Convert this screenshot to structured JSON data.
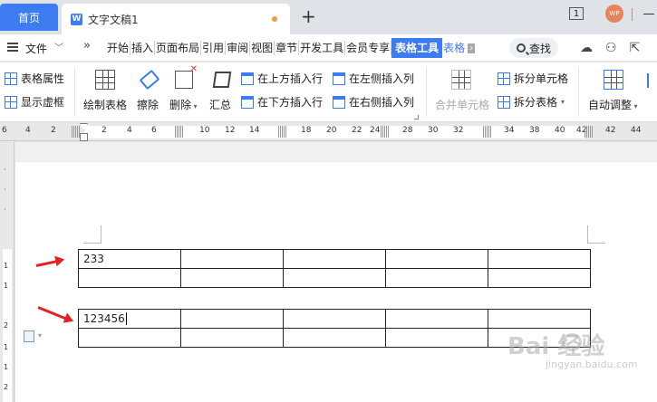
{
  "tabs": {
    "home": "首页",
    "document_title": "文字文稿1",
    "doc_icon": "W",
    "new_tab": "+",
    "window_count": "1",
    "avatar": "WP"
  },
  "menu": {
    "file": "文件",
    "items": [
      "开始",
      "插入",
      "页面布局",
      "引用",
      "审阅",
      "视图",
      "章节",
      "开发工具",
      "会员专享"
    ],
    "active": "表格工具",
    "tail": "表格",
    "search": "查找"
  },
  "ribbon": {
    "table_props": "表格属性",
    "show_gridlines": "显示虚框",
    "draw_table": "绘制表格",
    "erase": "擦除",
    "delete": "删除",
    "sum": "汇总",
    "insert_above": "在上方插入行",
    "insert_below": "在下方插入行",
    "insert_left": "在左侧插入列",
    "insert_right": "在右侧插入列",
    "merge_cells": "合并单元格",
    "split_cells": "拆分单元格",
    "split_table": "拆分表格",
    "auto_fit": "自动调整"
  },
  "ruler": {
    "numbers": [
      "6",
      "4",
      "2",
      "2",
      "4",
      "6",
      "10",
      "12",
      "14",
      "18",
      "20",
      "22",
      "24",
      "28",
      "30",
      "32",
      "34",
      "38",
      "40",
      "42",
      "4",
      "42",
      "44"
    ]
  },
  "vruler": {
    "numbers": [
      "1",
      "1",
      "2",
      "1",
      "1",
      "2",
      "2"
    ]
  },
  "document": {
    "table1": [
      [
        "233",
        "",
        "",
        "",
        ""
      ],
      [
        "",
        "",
        "",
        "",
        ""
      ]
    ],
    "table2": [
      [
        "123456",
        "",
        "",
        "",
        ""
      ],
      [
        "",
        "",
        "",
        "",
        ""
      ]
    ]
  },
  "watermark": {
    "brand": "Bai  经验",
    "url": "jingyan.baidu.com"
  },
  "colors": {
    "accent": "#3d7bf0",
    "arrow": "#e32222"
  }
}
